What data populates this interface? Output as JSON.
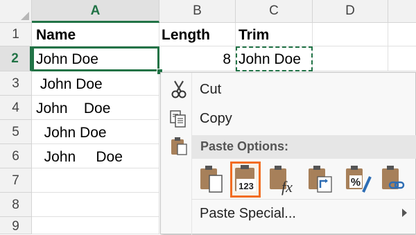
{
  "columns": [
    "A",
    "B",
    "C",
    "D"
  ],
  "rows": [
    "1",
    "2",
    "3",
    "4",
    "5",
    "6",
    "7",
    "8",
    "9"
  ],
  "cells": {
    "a1": "Name",
    "b1": "Length",
    "c1": "Trim",
    "a2": "John Doe",
    "b2": "8",
    "c2": "John Doe",
    "a3": " John Doe",
    "a4": "John    Doe",
    "a5": "  John Doe",
    "a6": "  John     Doe"
  },
  "context_menu": {
    "cut": "Cut",
    "copy": "Copy",
    "paste_options": "Paste Options:",
    "paste_special": "Paste Special...",
    "paste_buttons": [
      {
        "name": "paste-icon",
        "badge": ""
      },
      {
        "name": "paste-values-icon",
        "badge": "123"
      },
      {
        "name": "paste-formulas-icon",
        "badge": "fx"
      },
      {
        "name": "paste-transpose-icon",
        "badge": ""
      },
      {
        "name": "paste-formatting-icon",
        "badge": "%"
      },
      {
        "name": "paste-link-icon",
        "badge": ""
      }
    ]
  },
  "colors": {
    "accent": "#217346",
    "highlight": "#f26d21",
    "clipboard": "#a7805a",
    "header_bg": "#f2f2f2"
  }
}
